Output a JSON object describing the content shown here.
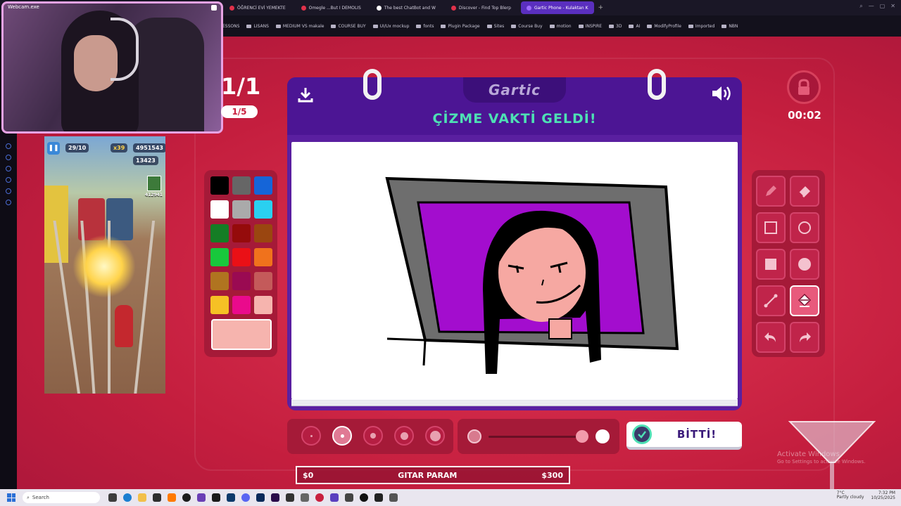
{
  "browser": {
    "tabs": [
      {
        "label": "ÖĞRENCİ EVİ YEMEKTE"
      },
      {
        "label": "Omegle ...But I DEMOLIS"
      },
      {
        "label": "The best ChatBot and W"
      },
      {
        "label": "Discover - Find Top Blerp"
      },
      {
        "label": "Gartic Phone - Kulaktan K"
      }
    ],
    "new_tab": "+",
    "bookmarks": [
      "ESSONS",
      "LISANS",
      "MEDIUM VS makale",
      "COURSE BUY",
      "UI/Ux mockup",
      "fonts",
      "Plugin Package",
      "Sites",
      "Course Buy",
      "motion",
      "INSPIRE",
      "3D",
      "AI",
      "ModifyProfile",
      "Imported",
      "NBN"
    ]
  },
  "webcam": {
    "title": "Webcam.exe"
  },
  "mobile_game": {
    "progress": "29/10",
    "multiplier": "x39",
    "score": "4951543",
    "coins": "13423",
    "top_score": "412941"
  },
  "round": {
    "big": "1/1",
    "pill": "1/5"
  },
  "palette": {
    "colors": [
      "#000000",
      "#666666",
      "#1565d8",
      "#ffffff",
      "#aaaaaa",
      "#2ad0f0",
      "#157d25",
      "#950b0b",
      "#9a4610",
      "#18c83c",
      "#ea1016",
      "#f0721c",
      "#b07420",
      "#9a0a52",
      "#c45a5a",
      "#f6c125",
      "#ea0a8c",
      "#f6b4ae"
    ],
    "current": "#f6b4ae"
  },
  "board": {
    "logo": "Gartic",
    "title": "ÇİZME VAKTİ GELDİ!"
  },
  "timer": {
    "value": "00:02"
  },
  "tools": [
    {
      "name": "pencil-tool"
    },
    {
      "name": "eraser-tool"
    },
    {
      "name": "rectangle-outline-tool"
    },
    {
      "name": "ellipse-outline-tool"
    },
    {
      "name": "rectangle-fill-tool"
    },
    {
      "name": "ellipse-fill-tool"
    },
    {
      "name": "line-tool"
    },
    {
      "name": "fill-bucket-tool"
    },
    {
      "name": "undo-tool"
    },
    {
      "name": "redo-tool"
    }
  ],
  "selected_tool": "fill-bucket-tool",
  "brush": {
    "selected_size_index": 1,
    "size_count": 5
  },
  "actions": {
    "done_label": "BİTTİ!"
  },
  "donation": {
    "left": "$0",
    "goal_label": "GITAR PARAM",
    "right": "$300"
  },
  "watermark": {
    "line1": "Activate Windows",
    "line2": "Go to Settings to activate Windows."
  },
  "taskbar": {
    "search_placeholder": "Search",
    "weather_temp": "7°C",
    "weather_desc": "Partly cloudy",
    "time": "7:32 PM",
    "date": "10/25/2025"
  }
}
